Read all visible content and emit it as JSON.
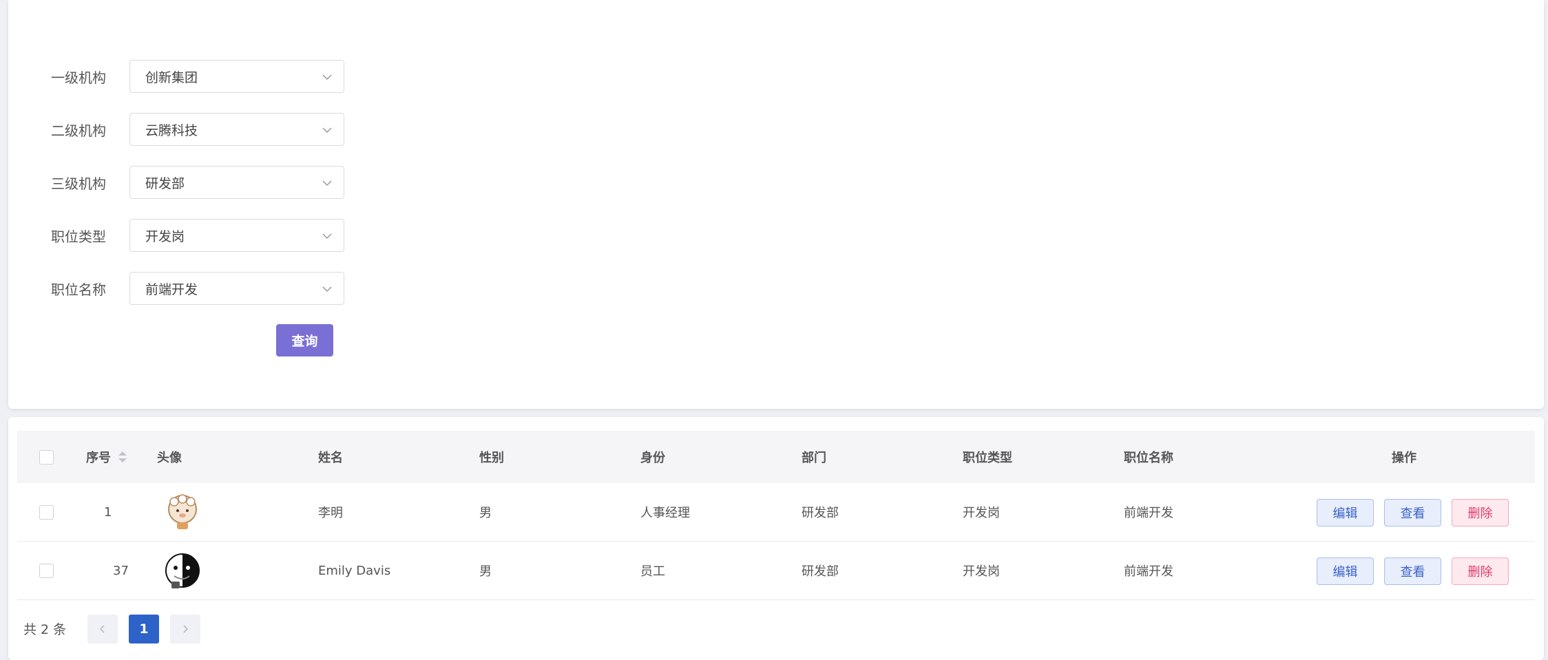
{
  "filters": [
    {
      "label": "一级机构",
      "value": "创新集团"
    },
    {
      "label": "二级机构",
      "value": "云腾科技"
    },
    {
      "label": "三级机构",
      "value": "研发部"
    },
    {
      "label": "职位类型",
      "value": "开发岗"
    },
    {
      "label": "职位名称",
      "value": "前端开发"
    }
  ],
  "query_label": "查询",
  "table": {
    "headers": {
      "index": "序号",
      "avatar": "头像",
      "name": "姓名",
      "gender": "性别",
      "role": "身份",
      "dept": "部门",
      "job_type": "职位类型",
      "job_name": "职位名称",
      "ops": "操作"
    },
    "rows": [
      {
        "index": "1",
        "name": "李明",
        "gender": "男",
        "role": "人事经理",
        "dept": "研发部",
        "job_type": "开发岗",
        "job_name": "前端开发"
      },
      {
        "index": "37",
        "name": "Emily Davis",
        "gender": "男",
        "role": "员工",
        "dept": "研发部",
        "job_type": "开发岗",
        "job_name": "前端开发"
      }
    ],
    "actions": {
      "edit": "编辑",
      "view": "查看",
      "delete": "删除"
    }
  },
  "pagination": {
    "total_text": "共 2 条",
    "current_page": "1"
  },
  "colors": {
    "primary": "#7a6fd4",
    "page_active": "#2d62c8",
    "danger": "#e03c6a"
  }
}
